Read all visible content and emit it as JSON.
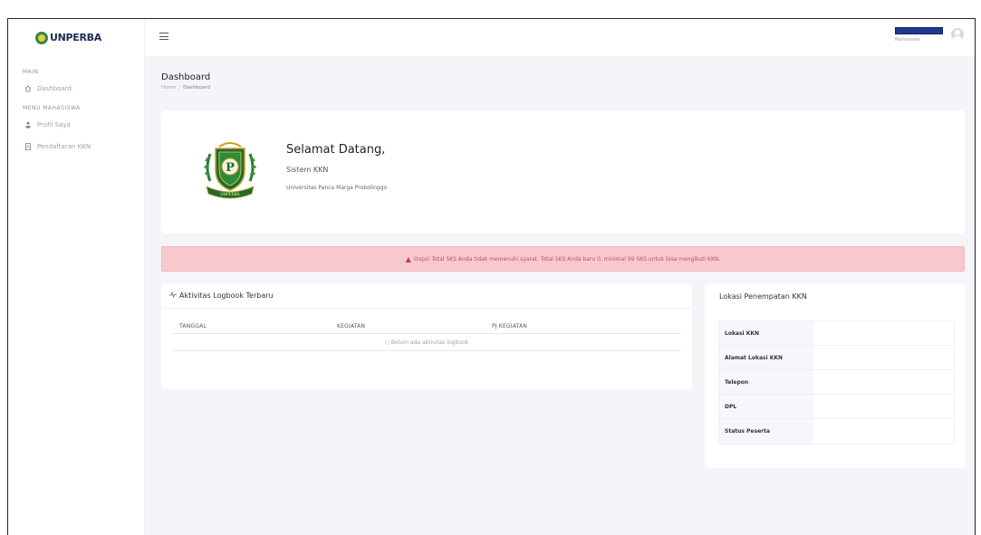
{
  "brand": {
    "name": "UNPERBA"
  },
  "sidebar": {
    "sections": [
      {
        "title": "MAIN",
        "items": [
          {
            "label": "Dashboard",
            "icon": "home-icon"
          }
        ]
      },
      {
        "title": "MENU MAHASISWA",
        "items": [
          {
            "label": "Profil Saya",
            "icon": "user-icon"
          },
          {
            "label": "Pendaftaran KKN",
            "icon": "document-icon"
          }
        ]
      }
    ]
  },
  "header": {
    "user_name": "Mahasiswa"
  },
  "page": {
    "title": "Dashboard",
    "breadcrumb": [
      "Home",
      "Dashboard"
    ]
  },
  "welcome": {
    "title": "Selamat Datang,",
    "subtitle": "Sistem KKN",
    "university": "Universitas Panca Marga Probolinggo",
    "seal_letter": "P",
    "seal_ribbon": "UNPERBA"
  },
  "alert": {
    "text": "Oops! Total SKS Anda tidak memenuhi syarat. Total SKS Anda baru 0, minimal 99 SKS untuk bisa mengikuti KKN."
  },
  "logbook": {
    "title": "Aktivitas Logbook Terbaru",
    "columns": [
      "TANGGAL",
      "KEGIATAN",
      "PJ KEGIATAN"
    ],
    "empty_text": "Belum ada aktivitas logbook"
  },
  "lokasi": {
    "title": "Lokasi Penempatan KKN",
    "rows": [
      {
        "label": "Lokasi KKN",
        "value": ""
      },
      {
        "label": "Alamat Lokasi KKN",
        "value": ""
      },
      {
        "label": "Telepon",
        "value": ""
      },
      {
        "label": "DPL",
        "value": ""
      },
      {
        "label": "Status Peserta",
        "value": ""
      }
    ]
  },
  "colors": {
    "brand_green": "#2e8b3a",
    "alert_bg": "#f7c9cf",
    "alert_text": "#c94a5a",
    "user_bar": "#1f3a93"
  }
}
